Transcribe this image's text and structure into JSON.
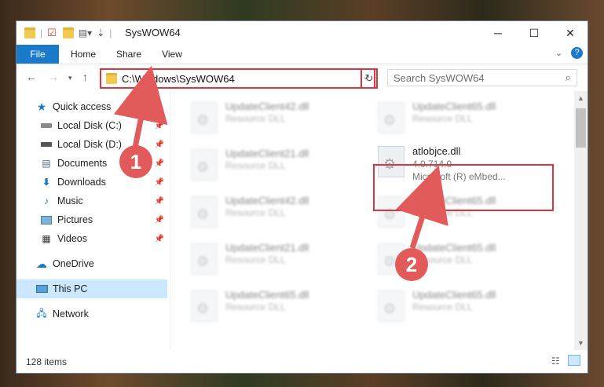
{
  "window": {
    "title": "SysWOW64"
  },
  "ribbon": {
    "tabs": [
      "File",
      "Home",
      "Share",
      "View"
    ]
  },
  "address": {
    "path": "C:\\Windows\\SysWOW64",
    "search_placeholder": "Search SysWOW64"
  },
  "sidebar": {
    "quick_access": "Quick access",
    "items": [
      "Local Disk (C:)",
      "Local Disk (D:)",
      "Documents",
      "Downloads",
      "Music",
      "Pictures",
      "Videos"
    ],
    "onedrive": "OneDrive",
    "this_pc": "This PC",
    "network": "Network"
  },
  "files": {
    "col1": [
      {
        "name": "UpdateClient42.dll",
        "desc": "Resource DLL"
      },
      {
        "name": "UpdateClient21.dll",
        "desc": "Resource DLL"
      },
      {
        "name": "UpdateClient42.dll",
        "desc": "Resource DLL"
      },
      {
        "name": "UpdateClient21.dll",
        "desc": "Resource DLL"
      },
      {
        "name": "UpdateClient65.dll",
        "desc": "Resource DLL"
      }
    ],
    "col2": [
      {
        "name": "UpdateClient65.dll",
        "desc": "Resource DLL"
      },
      {
        "name": "atlobjce.dll",
        "desc": "4.0.714.0",
        "company": "Microsoft (R) eMbed..."
      },
      {
        "name": "UpdateClient65.dll",
        "desc": "Resource DLL"
      },
      {
        "name": "UpdateClient65.dll",
        "desc": "Resource DLL"
      },
      {
        "name": "UpdateClient65.dll",
        "desc": "Resource DLL"
      }
    ]
  },
  "annotations": {
    "badge1": "1",
    "badge2": "2"
  },
  "status": {
    "count": "128 items"
  }
}
